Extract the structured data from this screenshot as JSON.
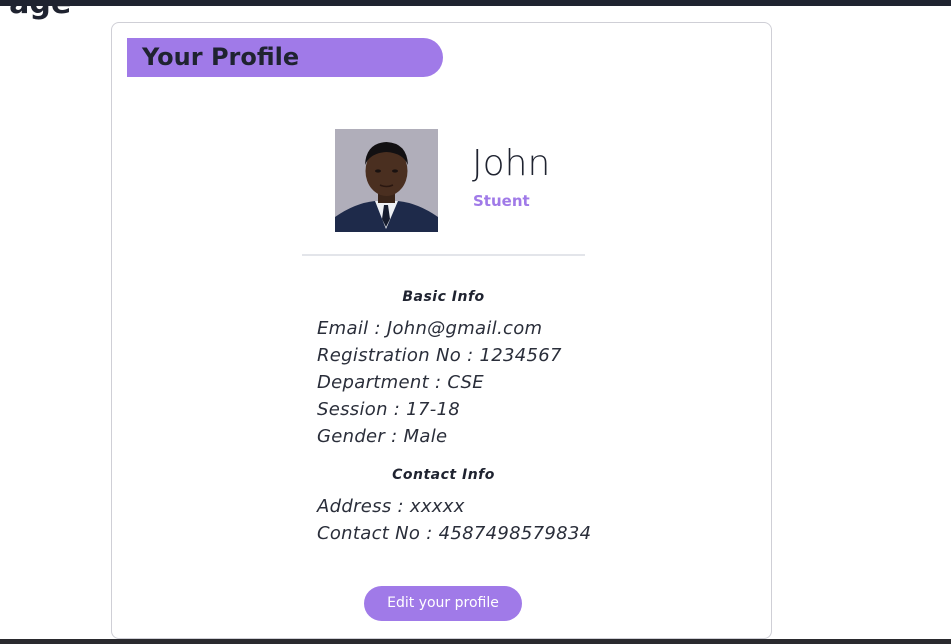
{
  "page": {
    "background_heading": "Page"
  },
  "profile": {
    "header": "Your Profile",
    "name": "John",
    "role": "Stuent",
    "avatar_alt": "profile-photo"
  },
  "basic_info": {
    "title": "Basic Info",
    "rows": [
      "Email : John@gmail.com",
      "Registration No : 1234567",
      "Department : CSE",
      "Session : 17-18",
      "Gender : Male"
    ]
  },
  "contact_info": {
    "title": "Contact Info",
    "rows": [
      "Address : xxxxx",
      "Contact No : 4587498579834"
    ]
  },
  "actions": {
    "edit_label": "Edit your profile"
  },
  "colors": {
    "accent": "#a07ae8",
    "text": "#1f2330",
    "card_border": "#cfcfd6"
  }
}
